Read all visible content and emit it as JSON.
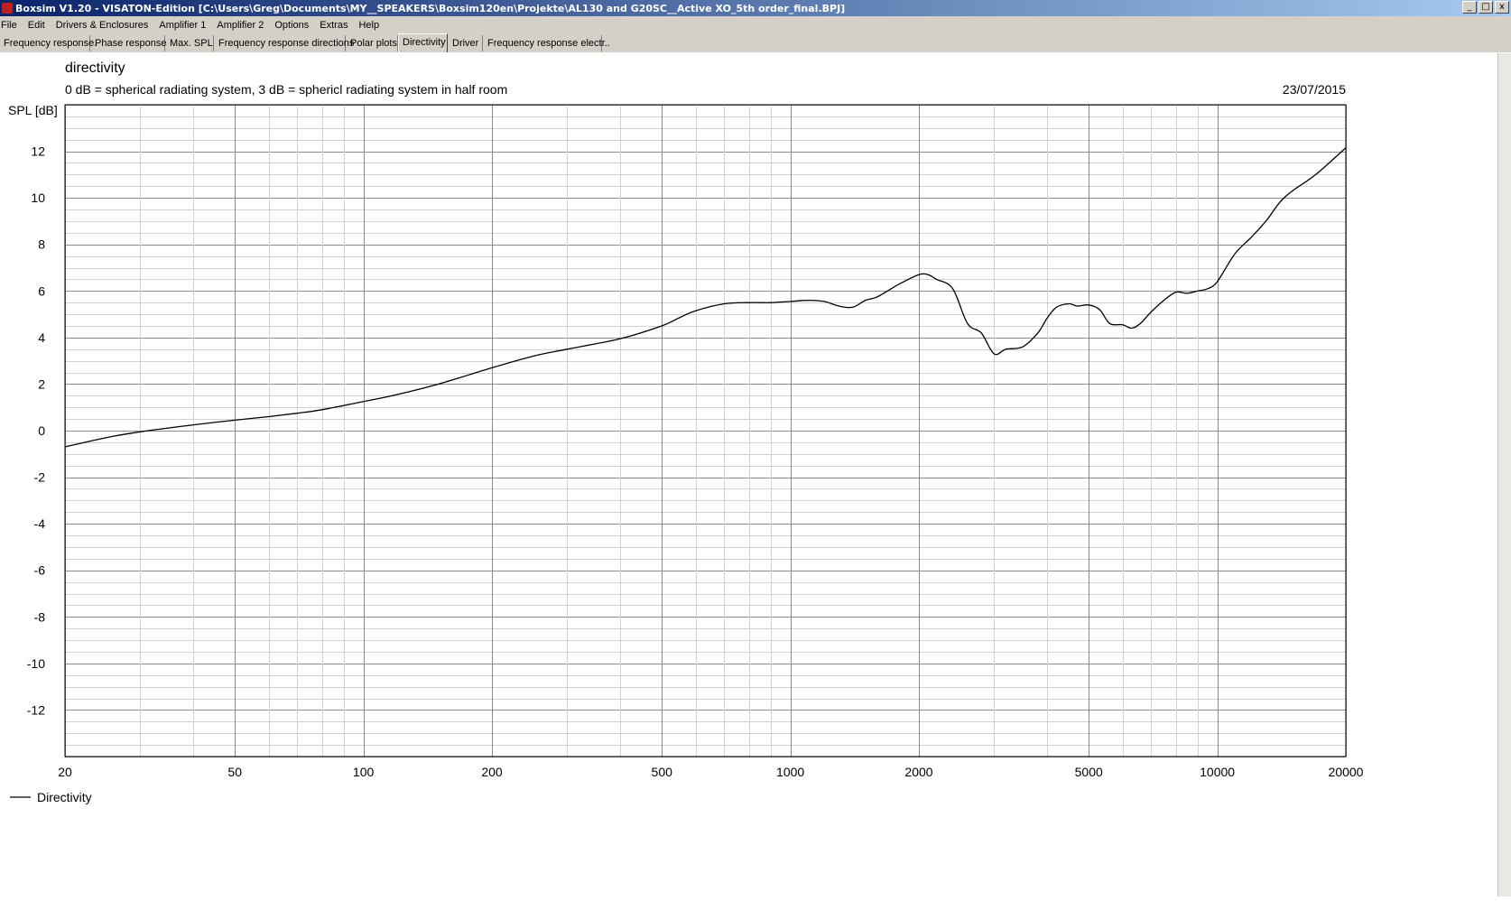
{
  "window": {
    "title": "Boxsim V1.20 - VISATON-Edition [C:\\Users\\Greg\\Documents\\MY__SPEAKERS\\Boxsim120en\\Projekte\\AL130 and G20SC__Active XO_5th order_final.BPJ]"
  },
  "window_buttons": {
    "minimize": "_",
    "maximize": "□",
    "close": "x"
  },
  "menu": [
    "File",
    "Edit",
    "Drivers & Enclosures",
    "Amplifier 1",
    "Amplifier 2",
    "Options",
    "Extras",
    "Help"
  ],
  "tabs": [
    "Frequency response.",
    "Phase response",
    "Max. SPL",
    "Frequency response directions",
    "Polar plots",
    "Directivity",
    "Driver",
    "Frequency response electr.."
  ],
  "active_tab": "Directivity",
  "chart_data": {
    "type": "line",
    "title": "directivity",
    "subtitle": "0 dB = spherical radiating system, 3 dB = sphericl radiating system in half room",
    "date": "23/07/2015",
    "ylabel": "SPL [dB]",
    "xlabel": "",
    "xscale": "log",
    "xlim": [
      20,
      20000
    ],
    "ylim": [
      -14,
      14
    ],
    "xticks": [
      20,
      50,
      100,
      200,
      500,
      1000,
      2000,
      5000,
      10000,
      20000
    ],
    "yticks": [
      -12,
      -10,
      -8,
      -6,
      -4,
      -2,
      0,
      2,
      4,
      6,
      8,
      10,
      12
    ],
    "grid": true,
    "legend": "bottom-left",
    "series": [
      {
        "name": "Directivity",
        "color": "#000000",
        "x": [
          20,
          25,
          30,
          40,
          50,
          60,
          70,
          80,
          100,
          120,
          150,
          200,
          250,
          300,
          400,
          500,
          550,
          600,
          700,
          800,
          900,
          1000,
          1100,
          1200,
          1300,
          1400,
          1500,
          1600,
          1800,
          2000,
          2100,
          2200,
          2400,
          2600,
          2800,
          3000,
          3200,
          3500,
          3800,
          4000,
          4200,
          4500,
          4700,
          5000,
          5300,
          5600,
          6000,
          6300,
          6600,
          7000,
          7500,
          8000,
          8500,
          9000,
          9500,
          10000,
          11000,
          12000,
          13000,
          14000,
          15000,
          17000,
          20000
        ],
        "values": [
          -0.7,
          -0.3,
          -0.05,
          0.25,
          0.45,
          0.6,
          0.75,
          0.9,
          1.25,
          1.55,
          2.0,
          2.7,
          3.2,
          3.5,
          3.95,
          4.5,
          4.85,
          5.15,
          5.45,
          5.5,
          5.5,
          5.55,
          5.6,
          5.55,
          5.35,
          5.3,
          5.6,
          5.75,
          6.3,
          6.7,
          6.7,
          6.5,
          6.1,
          4.6,
          4.2,
          3.3,
          3.5,
          3.6,
          4.2,
          4.85,
          5.3,
          5.45,
          5.35,
          5.4,
          5.2,
          4.6,
          4.55,
          4.4,
          4.6,
          5.1,
          5.6,
          5.95,
          5.9,
          6.0,
          6.1,
          6.4,
          7.6,
          8.3,
          9.0,
          9.8,
          10.3,
          11.0,
          12.15
        ]
      }
    ]
  }
}
